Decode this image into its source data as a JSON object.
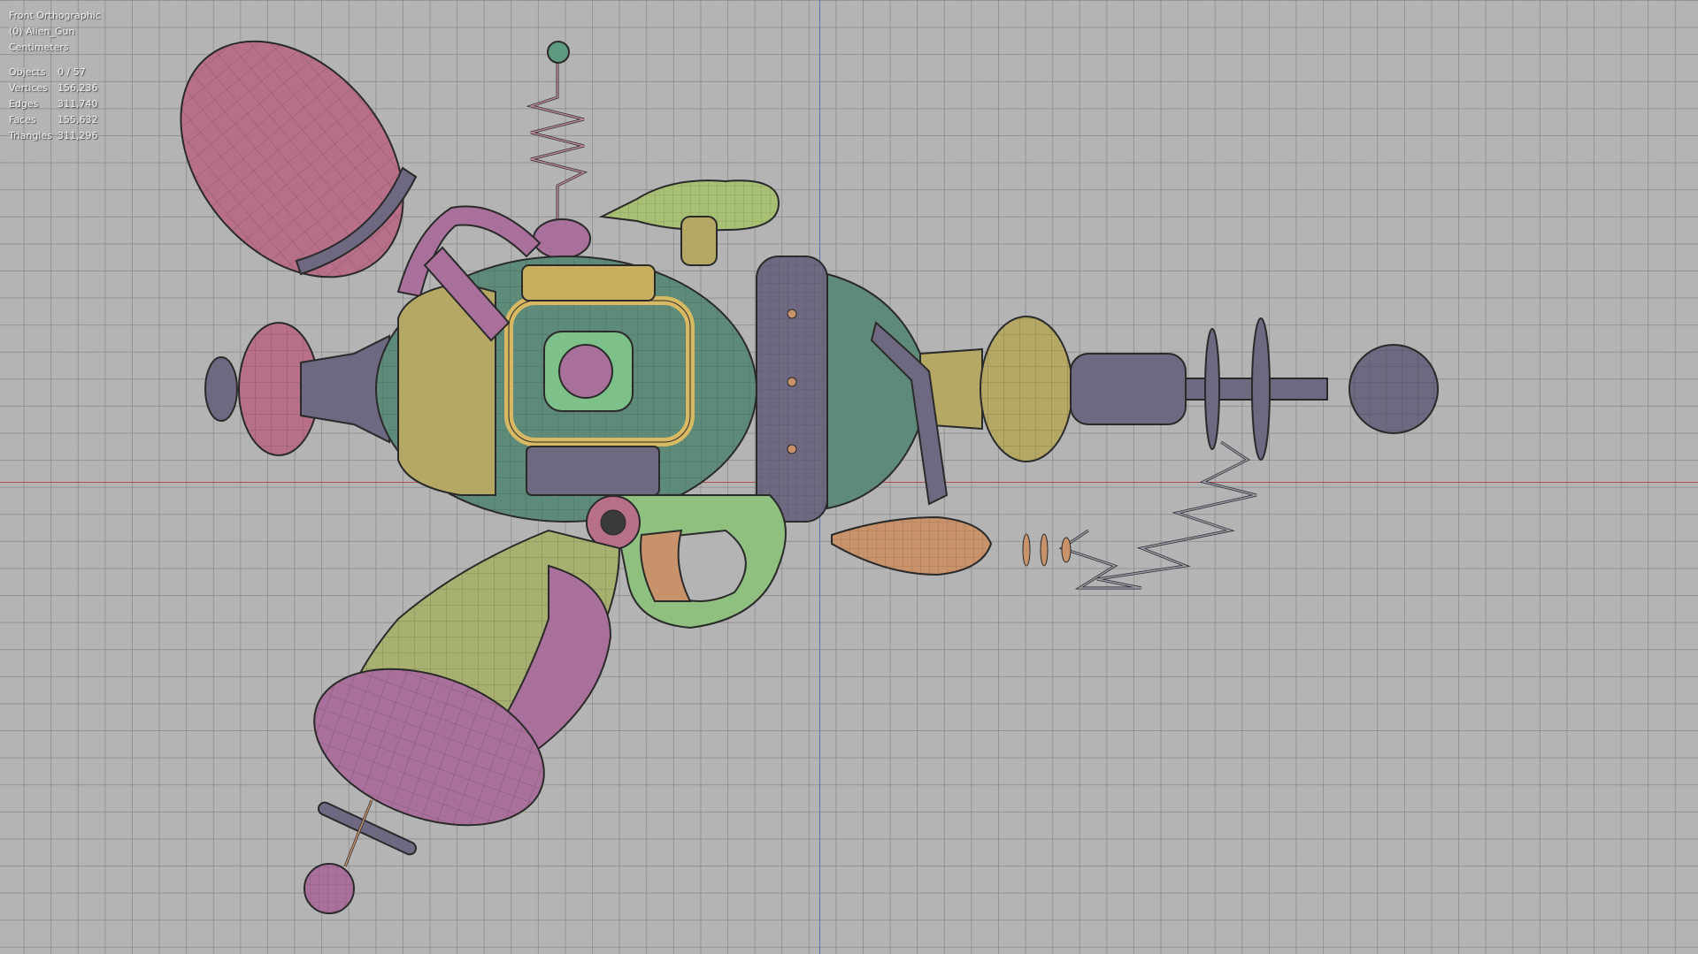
{
  "viewport": {
    "view_name": "Front Orthographic",
    "object_name": "(0) Alien_Gun",
    "units": "Centimeters"
  },
  "stats": [
    {
      "label": "Objects",
      "value": "0 / 57"
    },
    {
      "label": "Vertices",
      "value": "156,236"
    },
    {
      "label": "Edges",
      "value": "311,740"
    },
    {
      "label": "Faces",
      "value": "155,632"
    },
    {
      "label": "Triangles",
      "value": "311,296"
    }
  ],
  "colors": {
    "background": "#b4b4b4",
    "grid_line": "#8c8c8c",
    "x_axis": "#b05050",
    "z_axis": "#5570b0",
    "teal_body": "#5e8a7a",
    "pink": "#b8708a",
    "magenta": "#a8709a",
    "yellow_green": "#a8b070",
    "olive_gold": "#b5a764",
    "purple_gray": "#6e6880",
    "lime": "#9fc078",
    "orange": "#c8926a",
    "wire": "#2a2a2a"
  }
}
